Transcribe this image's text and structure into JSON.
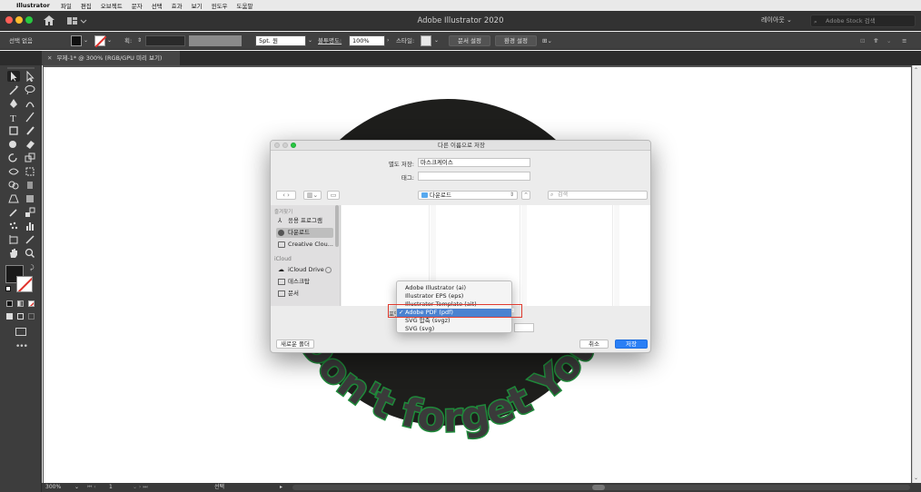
{
  "menubar": {
    "app": "Illustrator",
    "items": [
      "파일",
      "편집",
      "오브젝트",
      "문자",
      "선택",
      "효과",
      "보기",
      "윈도우",
      "도움말"
    ]
  },
  "titlebar": {
    "title": "Adobe Illustrator 2020",
    "layout_label": "레이아웃",
    "stock_search_placeholder": "Adobe Stock 검색"
  },
  "controlbar": {
    "selection_label": "선택 없음",
    "stroke_label": "획:",
    "brush_value": "5pt. 원",
    "opacity_label": "불투명도:",
    "opacity_value": "100%",
    "style_label": "스타일:",
    "doc_setup_button": "문서 설정",
    "preferences_button": "환경 설정"
  },
  "document": {
    "tab_title": "무제-1* @ 300% (RGB/GPU 미리 보기)",
    "artwork_text": "Don't forget You"
  },
  "statusbar": {
    "zoom": "300%",
    "page": "1",
    "status": "선택"
  },
  "dialog": {
    "title": "다른 이름으로 저장",
    "save_as_label": "별도 저장:",
    "save_as_value": "마스크케이스",
    "tags_label": "태그:",
    "location": "다운로드",
    "search_placeholder": "검색",
    "sidebar": {
      "favorites_header": "즐겨찾기",
      "favorites": [
        "응용 프로그램",
        "다운로드",
        "Creative Clou..."
      ],
      "icloud_header": "iCloud",
      "icloud": [
        "iCloud Drive",
        "데스크탑",
        "문서"
      ]
    },
    "format_label": "포맷:",
    "new_folder_button": "새로운 폴더",
    "cancel_button": "취소",
    "save_button": "저장"
  },
  "format_menu": {
    "options": [
      "Adobe Illustrator (ai)",
      "Illustrator EPS (eps)",
      "Illustrator Template (ait)",
      "Adobe PDF (pdf)",
      "SVG 압축 (svgz)",
      "SVG (svg)"
    ],
    "selected": "Adobe PDF (pdf)",
    "highlight_color": "#e03b2f"
  },
  "colors": {
    "ui_dark": "#323232",
    "artwork_circle": "#1e1e1c",
    "artwork_text_fill": "#3a3a3a",
    "artwork_text_stroke": "#1f8a3a",
    "accent_blue": "#2a7ff5"
  }
}
